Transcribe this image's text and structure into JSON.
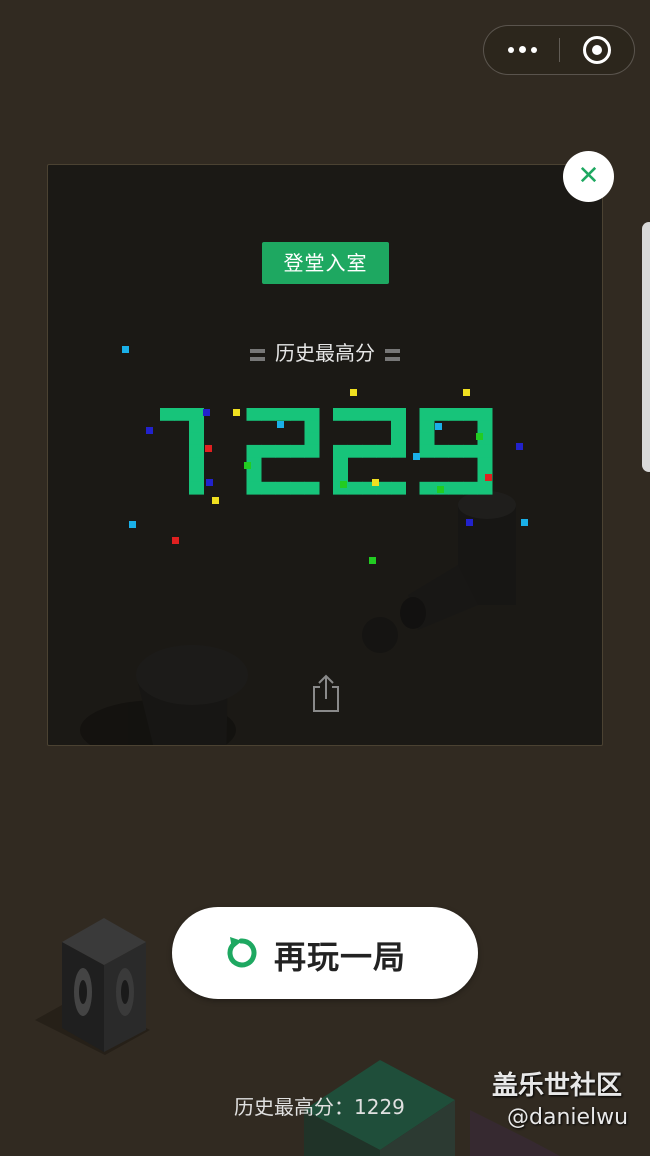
{
  "card": {
    "badge": "登堂入室",
    "best_label": "历史最高分",
    "score": "1229"
  },
  "replay_label": "再玩一局",
  "bottom": {
    "best_label": "历史最高分：",
    "best_value": "1229"
  },
  "watermark": {
    "site": "盖乐世社区",
    "user": "@danielwu"
  },
  "colors": {
    "accent": "#1ea861",
    "digit": "#17c47a"
  },
  "icons": [
    "more-icon",
    "target-icon",
    "close-icon",
    "share-icon",
    "replay-icon"
  ]
}
